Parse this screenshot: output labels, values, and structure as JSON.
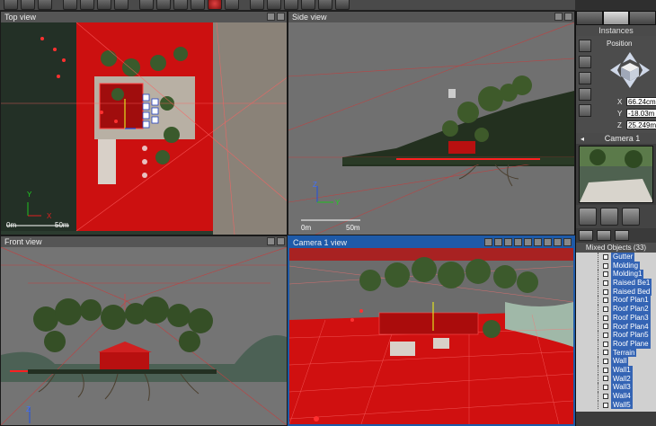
{
  "viewports": {
    "top": {
      "title": "Top view",
      "scale_start": "0m",
      "scale_end": "50m",
      "axis_y": "Y",
      "axis_x": "X"
    },
    "side": {
      "title": "Side view",
      "scale_start": "0m",
      "scale_end": "50m",
      "axis_z": "Z",
      "axis_y": "Y"
    },
    "front": {
      "title": "Front view",
      "axis_z": "Z"
    },
    "camera": {
      "title": "Camera 1 view"
    }
  },
  "panel": {
    "instances_label": "Instances",
    "position_label": "Position",
    "coords": [
      {
        "axis": "X",
        "value": "66.24cm"
      },
      {
        "axis": "Y",
        "value": "-18.03m"
      },
      {
        "axis": "Z",
        "value": "25.249m"
      }
    ],
    "camera_name": "Camera 1",
    "camera_prev": "◂",
    "mixed_objects_label": "Mixed Objects (33)",
    "objects": [
      "Gutter",
      "Molding",
      "Molding1",
      "Raised Be1",
      "Raised Bed",
      "Roof Plan1",
      "Roof Plan2",
      "Roof Plan3",
      "Roof Plan4",
      "Roof Plan5",
      "Roof Plane",
      "Terrain",
      "Wall",
      "Wall1",
      "Wall2",
      "Wall3",
      "Wall4",
      "Wall5"
    ]
  },
  "colors": {
    "selection_red": "#e01010",
    "active_blue": "#1e5aa8",
    "list_highlight": "#3464b4"
  }
}
